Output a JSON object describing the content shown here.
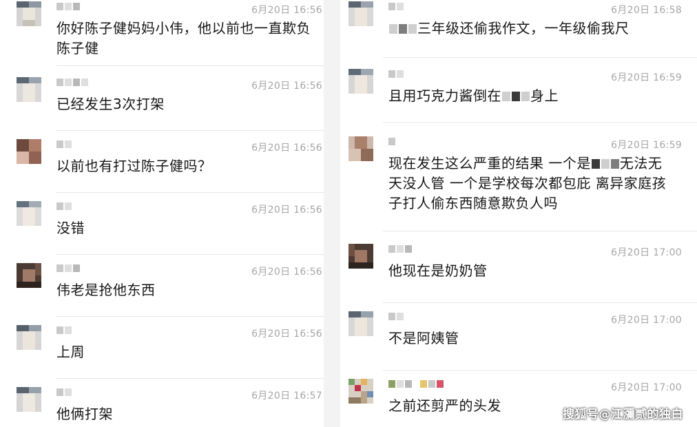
{
  "chat_left": {
    "messages": [
      {
        "time": "6月20日 16:56",
        "text": "你好陈子健妈妈小伟，他以前也一直欺负陈子健",
        "avatar": "pixelated-avatar-gray"
      },
      {
        "time": "6月20日 16:56",
        "text": "已经发生3次打架",
        "avatar": "pixelated-avatar-gray"
      },
      {
        "time": "6月20日 16:56",
        "text": "以前也有打过陈子健吗？",
        "avatar": "pixelated-avatar-brown"
      },
      {
        "time": "6月20日 16:56",
        "text": "没错",
        "avatar": "pixelated-avatar-gray"
      },
      {
        "time": "6月20日 16:56",
        "text": "伟老是抢他东西",
        "avatar": "pixelated-avatar-dark"
      },
      {
        "time": "6月20日 16:56",
        "text": "上周",
        "avatar": "pixelated-avatar-gray"
      },
      {
        "time": "6月20日 16:57",
        "text": "他俩打架",
        "avatar": "pixelated-avatar-gray"
      }
    ]
  },
  "chat_right": {
    "messages": [
      {
        "time": "6月20日 16:58",
        "text_before": "",
        "text_after": "三年级还偷我作文，一年级偷我尺",
        "avatar": "pixelated-avatar-gray"
      },
      {
        "time": "6月20日 16:59",
        "text_before": "且用巧克力酱倒在",
        "text_after": "身上",
        "avatar": "pixelated-avatar-gray"
      },
      {
        "time": "6月20日 16:59",
        "text_before": "现在发生这么严重的结果  一个是",
        "text_after": "无法无天没人管  一个是学校每次都包庇  离异家庭孩子打人偷东西随意欺负人吗",
        "avatar": "pixelated-avatar-brown"
      },
      {
        "time": "6月20日 17:00",
        "text": "他现在是奶奶管",
        "avatar": "pixelated-avatar-dark"
      },
      {
        "time": "6月20日 17:00",
        "text": "不是阿姨管",
        "avatar": "pixelated-avatar-gray"
      },
      {
        "time": "6月20日 17:00",
        "text": "之前还剪严的头发",
        "avatar": "pixelated-avatar-colorful"
      }
    ]
  },
  "watermark": "搜狐号@江瀰贰的独白"
}
